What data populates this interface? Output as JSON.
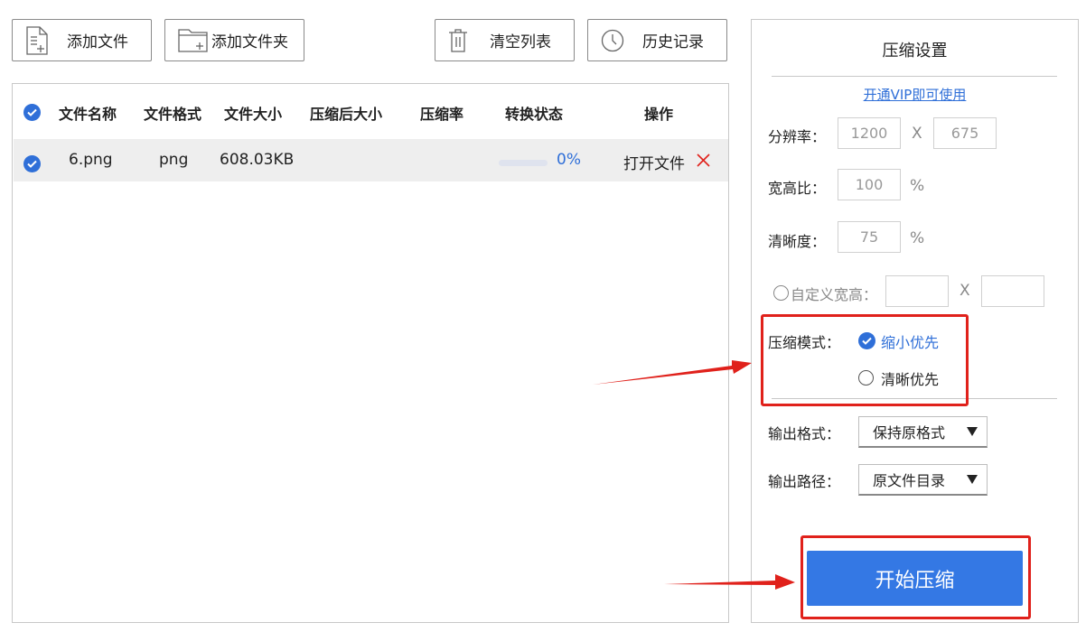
{
  "toolbar": {
    "add_file": "添加文件",
    "add_folder": "添加文件夹",
    "clear_list": "清空列表",
    "history": "历史记录"
  },
  "table": {
    "columns": [
      "文件名称",
      "文件格式",
      "文件大小",
      "压缩后大小",
      "压缩率",
      "转换状态",
      "操作"
    ],
    "rows": [
      {
        "name": "6.png",
        "format": "png",
        "size": "608.03KB",
        "compressed_size": "",
        "ratio": "",
        "progress": 0,
        "progress_text": "0%",
        "action": "打开文件"
      }
    ]
  },
  "settings": {
    "title": "压缩设置",
    "vip_link": "开通VIP即可使用",
    "resolution": {
      "label": "分辨率：",
      "width": "1200",
      "sep": "X",
      "height": "675"
    },
    "aspect": {
      "label": "宽高比：",
      "value": "100",
      "unit": "%"
    },
    "clarity": {
      "label": "清晰度：",
      "value": "75",
      "unit": "%"
    },
    "custom": {
      "label": "自定义宽高：",
      "sep": "X",
      "width": "",
      "height": ""
    },
    "mode": {
      "label": "压缩模式：",
      "options": [
        {
          "label": "缩小优先",
          "selected": true
        },
        {
          "label": "清晰优先",
          "selected": false
        }
      ]
    },
    "output_format": {
      "label": "输出格式：",
      "value": "保持原格式"
    },
    "output_path": {
      "label": "输出路径：",
      "value": "原文件目录"
    },
    "start_button": "开始压缩"
  },
  "colors": {
    "accent": "#2f6fd8",
    "primary_button": "#3478e4",
    "highlight_red": "#e0211b"
  }
}
